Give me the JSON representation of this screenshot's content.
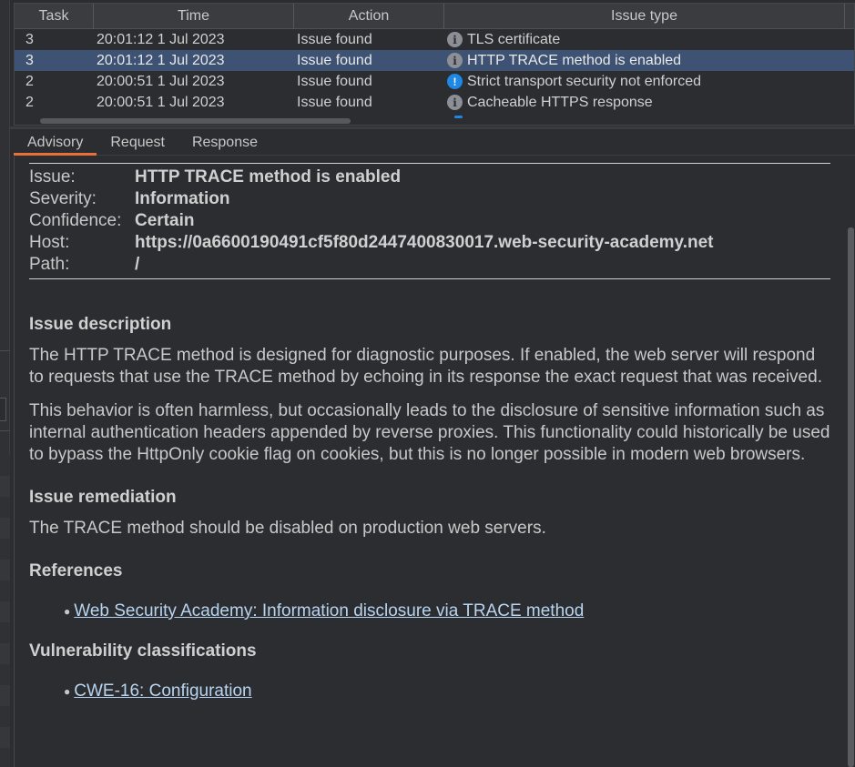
{
  "table": {
    "columns": {
      "task": "Task",
      "time": "Time",
      "action": "Action",
      "issue_type": "Issue type"
    },
    "rows": [
      {
        "task": "3",
        "time": "20:01:12 1 Jul 2023",
        "action": "Issue found",
        "icon": "info-icon",
        "issue": "TLS certificate"
      },
      {
        "task": "3",
        "time": "20:01:12 1 Jul 2023",
        "action": "Issue found",
        "icon": "info-icon",
        "issue": "HTTP TRACE method is enabled"
      },
      {
        "task": "2",
        "time": "20:00:51 1 Jul 2023",
        "action": "Issue found",
        "icon": "warning-icon",
        "issue": "Strict transport security not enforced"
      },
      {
        "task": "2",
        "time": "20:00:51 1 Jul 2023",
        "action": "Issue found",
        "icon": "info-icon",
        "issue": "Cacheable HTTPS response"
      }
    ],
    "selected_row": 1
  },
  "tabs": [
    "Advisory",
    "Request",
    "Response"
  ],
  "active_tab": "Advisory",
  "advisory": {
    "meta": [
      {
        "label": "Issue:",
        "value": "HTTP TRACE method is enabled"
      },
      {
        "label": "Severity:",
        "value": "Information"
      },
      {
        "label": "Confidence:",
        "value": "Certain"
      },
      {
        "label": "Host:",
        "value": "https://0a6600190491cf5f80d2447400830017.web-security-academy.net"
      },
      {
        "label": "Path:",
        "value": "/"
      }
    ],
    "issue_description_heading": "Issue description",
    "issue_description_p1": "The HTTP TRACE method is designed for diagnostic purposes. If enabled, the web server will respond to requests that use the TRACE method by echoing in its response the exact request that was received.",
    "issue_description_p2": "This behavior is often harmless, but occasionally leads to the disclosure of sensitive information such as internal authentication headers appended by reverse proxies. This functionality could historically be used to bypass the HttpOnly cookie flag on cookies, but this is no longer possible in modern web browsers.",
    "remediation_heading": "Issue remediation",
    "remediation_text": "The TRACE method should be disabled on production web servers.",
    "references_heading": "References",
    "references": [
      "Web Security Academy: Information disclosure via TRACE method"
    ],
    "classifications_heading": "Vulnerability classifications",
    "classifications": [
      "CWE-16: Configuration"
    ]
  },
  "colors": {
    "selection": "#3e5273",
    "tab_accent": "#e8703a",
    "warning_icon": "#1e88e5",
    "link": "#b8d4f0"
  }
}
